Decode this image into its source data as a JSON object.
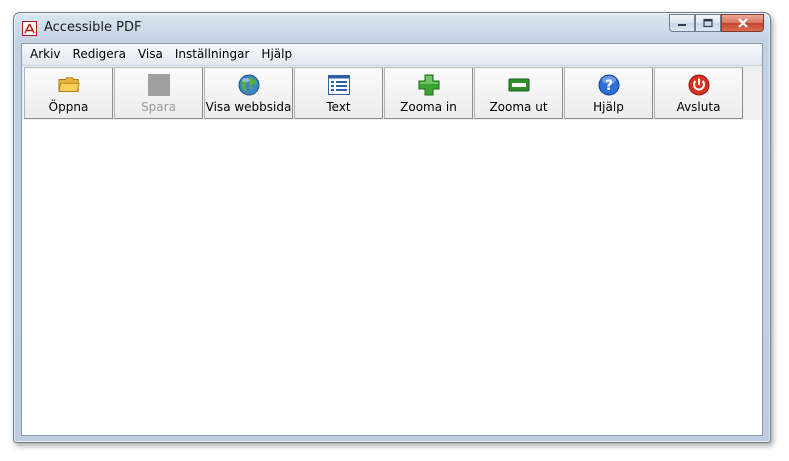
{
  "window": {
    "title": "Accessible PDF",
    "app_icon": "pdf-icon",
    "caption_buttons": [
      "minimize",
      "maximize",
      "close"
    ]
  },
  "menubar": {
    "items": [
      {
        "label": "Arkiv"
      },
      {
        "label": "Redigera"
      },
      {
        "label": "Visa"
      },
      {
        "label": "Inställningar"
      },
      {
        "label": "Hjälp"
      }
    ]
  },
  "toolbar": {
    "buttons": [
      {
        "label": "Öppna",
        "icon": "folder-icon",
        "enabled": true
      },
      {
        "label": "Spara",
        "icon": "save-icon",
        "enabled": false
      },
      {
        "label": "Visa webbsida",
        "icon": "globe-icon",
        "enabled": true
      },
      {
        "label": "Text",
        "icon": "text-icon",
        "enabled": true
      },
      {
        "label": "Zooma in",
        "icon": "zoom-in-icon",
        "enabled": true
      },
      {
        "label": "Zooma ut",
        "icon": "zoom-out-icon",
        "enabled": true
      },
      {
        "label": "Hjälp",
        "icon": "help-icon",
        "enabled": true
      },
      {
        "label": "Avsluta",
        "icon": "power-icon",
        "enabled": true
      }
    ]
  },
  "colors": {
    "title_bar": "#c3d3e4",
    "close_button": "#c5452a",
    "disabled_text": "#9a9a9a"
  }
}
